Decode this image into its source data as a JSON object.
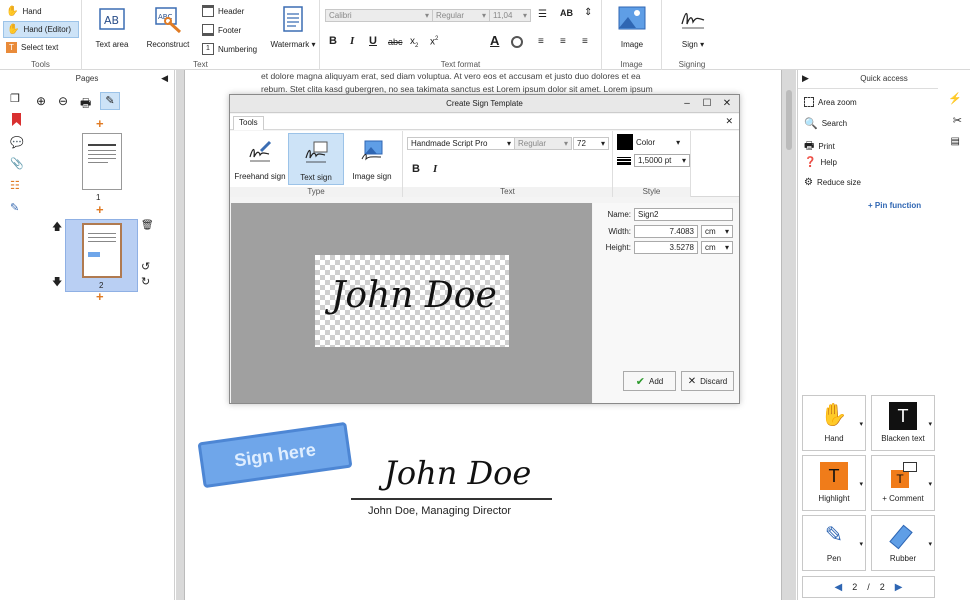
{
  "ribbon": {
    "tools": {
      "hand": "Hand",
      "hand_editor": "Hand (Editor)",
      "select_text": "Select text",
      "label": "Tools"
    },
    "text": {
      "text_area": "Text area",
      "reconstruct": "Reconstruct",
      "header": "Header",
      "footer": "Footer",
      "numbering": "Numbering",
      "watermark": "Watermark",
      "label": "Text"
    },
    "text_format": {
      "font": "Calibri",
      "style": "Regular",
      "size": "11,04",
      "bold": "B",
      "italic": "I",
      "underline": "U",
      "strike": "abc",
      "subscript": "x",
      "superscript": "x",
      "label": "Text format"
    },
    "image": {
      "button": "Image",
      "label": "Image"
    },
    "signing": {
      "button": "Sign",
      "label": "Signing"
    }
  },
  "pages_panel": {
    "title": "Pages",
    "page1_num": "1",
    "page2_num": "2"
  },
  "document": {
    "lorem_lines": [
      "et dolore magna aliquyam erat, sed diam voluptua. At vero eos et accusam et justo duo dolores et ea",
      "rebum. Stet clita kasd gubergren, no sea takimata sanctus est Lorem ipsum dolor sit amet. Lorem ipsum"
    ],
    "stamp_text": "Sign here",
    "signature": "John Doe",
    "signatory": "John Doe, Managing Director"
  },
  "dialog": {
    "title": "Create Sign Template",
    "tab": "Tools",
    "types": {
      "freehand": "Freehand sign",
      "text_sign": "Text sign",
      "image_sign": "Image sign",
      "label": "Type"
    },
    "text": {
      "font": "Handmade Script Pro",
      "style": "Regular",
      "size": "72",
      "bold": "B",
      "italic": "I",
      "label": "Text"
    },
    "style": {
      "color_label": "Color",
      "line_width": "1,5000 pt",
      "label": "Style"
    },
    "preview_text": "John Doe",
    "props": {
      "name_label": "Name:",
      "name_value": "Sign2",
      "width_label": "Width:",
      "width_value": "7.4083",
      "width_unit": "cm",
      "height_label": "Height:",
      "height_value": "3.5278",
      "height_unit": "cm"
    },
    "add": "Add",
    "discard": "Discard"
  },
  "quick_access": {
    "title": "Quick access",
    "items": [
      "Area zoom",
      "Search",
      "Print",
      "Help",
      "Reduce size"
    ],
    "pin": "+ Pin function",
    "tiles": {
      "hand": "Hand",
      "blacken": "Blacken text",
      "highlight": "Highlight",
      "comment": "+ Comment",
      "pen": "Pen",
      "rubber": "Rubber"
    },
    "pager": {
      "current": "2",
      "sep": "/",
      "total": "2"
    }
  }
}
